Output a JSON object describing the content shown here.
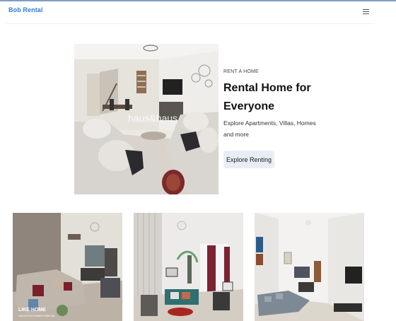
{
  "navbar": {
    "brand": "Bob Rental",
    "menu_icon": "hamburger-menu-icon"
  },
  "hero": {
    "eyebrow": "RENT A HOME",
    "title": "Rental Home for Everyone",
    "subtitle": "Explore Apartments, Villas, Homes and more",
    "cta_label": "Explore Renting",
    "watermark": "haus&haus"
  },
  "listings": [
    {
      "watermark_title": "LIKE HOME",
      "watermark_sub": "VACATION HOMES RENTAL"
    },
    {},
    {}
  ],
  "colors": {
    "brand": "#2f7bd8",
    "cta_bg": "#e9eef6"
  }
}
